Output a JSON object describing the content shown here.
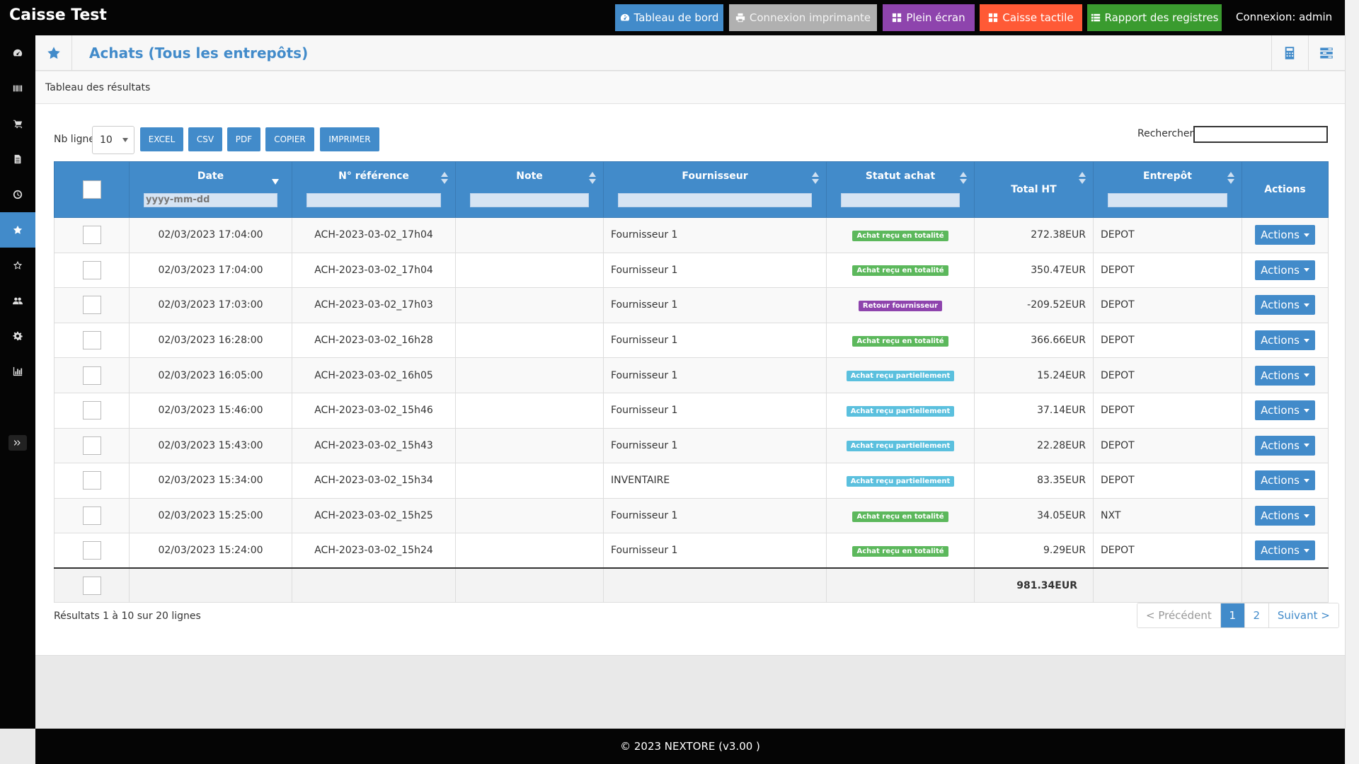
{
  "app": {
    "title": "Caisse Test",
    "connexion": "Connexion: admin"
  },
  "topbar": {
    "buttons": [
      {
        "label": "Tableau de bord",
        "color": "#428bca",
        "icon": "dashboard-icon"
      },
      {
        "label": "Connexion imprimante",
        "color": "#b0b0b0",
        "icon": "printer-icon"
      },
      {
        "label": "Plein écran",
        "color": "#8e44ad",
        "icon": "grid-icon"
      },
      {
        "label": "Caisse tactile",
        "color": "#ff5a36",
        "icon": "grid-icon"
      },
      {
        "label": "Rapport des registres",
        "color": "#3a9b2f",
        "icon": "list-icon"
      }
    ]
  },
  "page": {
    "title": "Achats (Tous les entrepôts)",
    "subtitle": "Tableau des résultats"
  },
  "toolbar": {
    "nb_ligne_label": "Nb ligne",
    "page_length": "10",
    "export_buttons": [
      "EXCEL",
      "CSV",
      "PDF",
      "COPIER",
      "IMPRIMER"
    ],
    "search_label": "Rechercher",
    "search_value": ""
  },
  "table": {
    "columns": [
      "Date",
      "N° référence",
      "Note",
      "Fournisseur",
      "Statut achat",
      "Total HT",
      "Entrepôt",
      "Actions"
    ],
    "date_filter_placeholder": "yyyy-mm-dd",
    "rows": [
      {
        "date": "02/03/2023 17:04:00",
        "ref": "ACH-2023-03-02_17h04",
        "note": "",
        "supplier": "Fournisseur 1",
        "status": "Achat reçu en totalité",
        "status_type": "green",
        "total": "272.38EUR",
        "warehouse": "DEPOT",
        "action": "Actions"
      },
      {
        "date": "02/03/2023 17:04:00",
        "ref": "ACH-2023-03-02_17h04",
        "note": "",
        "supplier": "Fournisseur 1",
        "status": "Achat reçu en totalité",
        "status_type": "green",
        "total": "350.47EUR",
        "warehouse": "DEPOT",
        "action": "Actions"
      },
      {
        "date": "02/03/2023 17:03:00",
        "ref": "ACH-2023-03-02_17h03",
        "note": "",
        "supplier": "Fournisseur 1",
        "status": "Retour fournisseur",
        "status_type": "purple",
        "total": "-209.52EUR",
        "warehouse": "DEPOT",
        "action": "Actions"
      },
      {
        "date": "02/03/2023 16:28:00",
        "ref": "ACH-2023-03-02_16h28",
        "note": "",
        "supplier": "Fournisseur 1",
        "status": "Achat reçu en totalité",
        "status_type": "green",
        "total": "366.66EUR",
        "warehouse": "DEPOT",
        "action": "Actions"
      },
      {
        "date": "02/03/2023 16:05:00",
        "ref": "ACH-2023-03-02_16h05",
        "note": "",
        "supplier": "Fournisseur 1",
        "status": "Achat reçu partiellement",
        "status_type": "blue",
        "total": "15.24EUR",
        "warehouse": "DEPOT",
        "action": "Actions"
      },
      {
        "date": "02/03/2023 15:46:00",
        "ref": "ACH-2023-03-02_15h46",
        "note": "",
        "supplier": "Fournisseur 1",
        "status": "Achat reçu partiellement",
        "status_type": "blue",
        "total": "37.14EUR",
        "warehouse": "DEPOT",
        "action": "Actions"
      },
      {
        "date": "02/03/2023 15:43:00",
        "ref": "ACH-2023-03-02_15h43",
        "note": "",
        "supplier": "Fournisseur 1",
        "status": "Achat reçu partiellement",
        "status_type": "blue",
        "total": "22.28EUR",
        "warehouse": "DEPOT",
        "action": "Actions"
      },
      {
        "date": "02/03/2023 15:34:00",
        "ref": "ACH-2023-03-02_15h34",
        "note": "",
        "supplier": "INVENTAIRE",
        "status": "Achat reçu partiellement",
        "status_type": "blue",
        "total": "83.35EUR",
        "warehouse": "DEPOT",
        "action": "Actions"
      },
      {
        "date": "02/03/2023 15:25:00",
        "ref": "ACH-2023-03-02_15h25",
        "note": "",
        "supplier": "Fournisseur 1",
        "status": "Achat reçu en totalité",
        "status_type": "green",
        "total": "34.05EUR",
        "warehouse": "NXT",
        "action": "Actions"
      },
      {
        "date": "02/03/2023 15:24:00",
        "ref": "ACH-2023-03-02_15h24",
        "note": "",
        "supplier": "Fournisseur 1",
        "status": "Achat reçu en totalité",
        "status_type": "green",
        "total": "9.29EUR",
        "warehouse": "DEPOT",
        "action": "Actions"
      }
    ],
    "footer_total": "981.34EUR"
  },
  "pagination": {
    "info": "Résultats 1 à 10 sur 20 lignes",
    "prev": "< Précédent",
    "pages": [
      "1",
      "2"
    ],
    "current": "1",
    "next": "Suivant >"
  },
  "footer": {
    "text": "© 2023 NEXTORE (v3.00 )"
  },
  "sidebar": {
    "items": [
      "dashboard-icon",
      "barcode-icon",
      "cart-icon",
      "document-icon",
      "clock-icon",
      "star-icon",
      "star-outline-icon",
      "users-icon",
      "gear-icon",
      "bar-chart-icon"
    ],
    "active": "star-icon"
  }
}
